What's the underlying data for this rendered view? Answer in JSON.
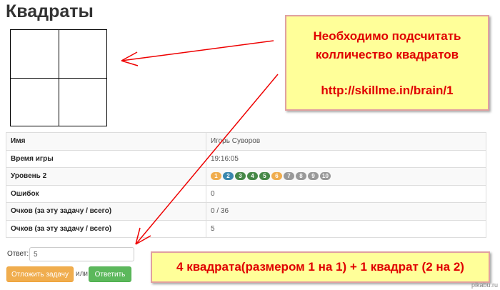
{
  "page": {
    "title": "Квадраты"
  },
  "colors": {
    "annotation_red": "#ee0000",
    "callout_bg": "#ffff99",
    "level_orange": "#f0ad4e",
    "level_blue": "#3a87ad",
    "level_green": "#468847",
    "level_grey": "#999999",
    "submit_green": "#5cb85c"
  },
  "stats": {
    "rows": [
      {
        "key": "Имя",
        "value": "Игорь Суворов"
      },
      {
        "key": "Время игры",
        "value": "19:16:05"
      },
      {
        "key": "Уровень 2",
        "value": ""
      },
      {
        "key": "Ошибок",
        "value": "0"
      },
      {
        "key": "Очков (за эту задачу / всего)",
        "value": "0 / 36"
      },
      {
        "key": "Очков (за эту задачу / всего)",
        "value": "5"
      }
    ],
    "levels": [
      {
        "n": "1",
        "color": "#f0ad4e"
      },
      {
        "n": "2",
        "color": "#3a87ad"
      },
      {
        "n": "3",
        "color": "#468847"
      },
      {
        "n": "4",
        "color": "#468847"
      },
      {
        "n": "5",
        "color": "#468847"
      },
      {
        "n": "6",
        "color": "#f0ad4e"
      },
      {
        "n": "7",
        "color": "#999999"
      },
      {
        "n": "8",
        "color": "#999999"
      },
      {
        "n": "9",
        "color": "#999999"
      },
      {
        "n": "10",
        "color": "#999999"
      }
    ]
  },
  "form": {
    "answer_label": "Ответ:",
    "answer_value": "5",
    "later_button": "Отложить задачу",
    "or_label": "или",
    "submit_button": "Ответить"
  },
  "annotations": {
    "callout_line1": "Необходимо подсчитать",
    "callout_line2": "колличество квадратов",
    "callout_url": "http://skillme.in/brain/1",
    "answer_note": "4 квадрата(размером 1 на 1) + 1 квадрат (2 на 2)"
  },
  "watermark": "pikabu.ru"
}
